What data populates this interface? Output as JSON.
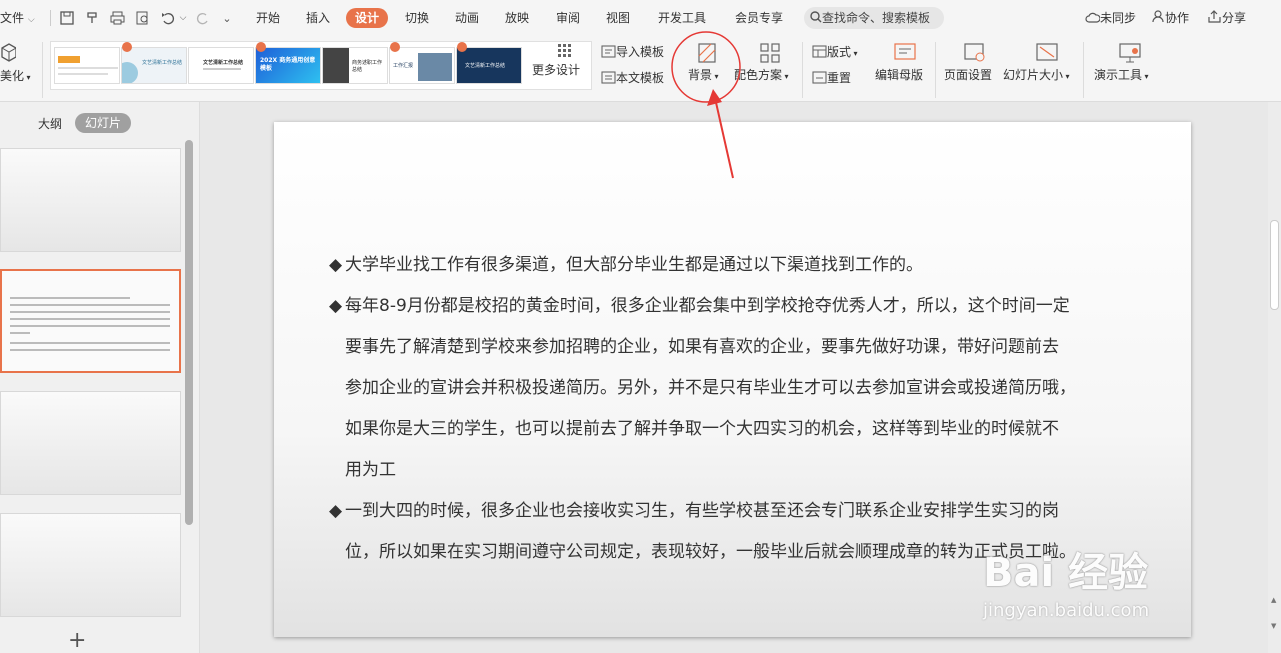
{
  "menubar": {
    "file_label": "文件",
    "tabs": [
      "开始",
      "插入",
      "设计",
      "切换",
      "动画",
      "放映",
      "审阅",
      "视图",
      "开发工具",
      "会员专享"
    ],
    "active_tab": "设计",
    "search_label": "查找命令、搜索模板",
    "sync_label": "未同步",
    "collab_label": "协作",
    "share_label": "分享"
  },
  "ribbon": {
    "beautify_label": "美化",
    "thumb_texts": [
      "",
      "文艺清新工作总结",
      "202X 商务通用创意模板",
      "商务述职工作总结",
      "工作汇报",
      "文艺清新工作总结"
    ],
    "more_design_label": "更多设计",
    "import_template_label": "导入模板",
    "text_template_label": "本文模板",
    "background_label": "背景",
    "color_scheme_label": "配色方案",
    "layout_label": "版式",
    "reset_label": "重置",
    "edit_master_label": "编辑母版",
    "page_setup_label": "页面设置",
    "slide_size_label": "幻灯片大小",
    "presentation_tools_label": "演示工具"
  },
  "panel": {
    "tab_outline": "大纲",
    "tab_slides": "幻灯片",
    "add_slide": "+"
  },
  "slide": {
    "paragraphs": [
      {
        "bullet": "◆",
        "lines": [
          "大学毕业找工作有很多渠道，但大部分毕业生都是通过以下渠道找到工作的。"
        ]
      },
      {
        "bullet": "◆",
        "lines": [
          "每年8-9月份都是校招的黄金时间，很多企业都会集中到学校抢夺优秀人才，所以，这个时间一定",
          "要事先了解清楚到学校来参加招聘的企业，如果有喜欢的企业，要事先做好功课，带好问题前去",
          "参加企业的宣讲会并积极投递简历。另外，并不是只有毕业生才可以去参加宣讲会或投递简历哦，",
          "如果你是大三的学生，也可以提前去了解并争取一个大四实习的机会，这样等到毕业的时候就不",
          "用为工"
        ]
      },
      {
        "bullet": "◆",
        "lines": [
          "一到大四的时候，很多企业也会接收实习生，有些学校甚至还会专门联系企业安排学生实习的岗",
          "位，所以如果在实习期间遵守公司规定，表现较好，一般毕业后就会顺理成章的转为正式员工啦。"
        ]
      }
    ]
  },
  "watermark": {
    "logo": "Bai 经验",
    "url": "jingyan.baidu.com"
  },
  "colors": {
    "accent": "#e8734a",
    "annotation": "#e53935"
  }
}
